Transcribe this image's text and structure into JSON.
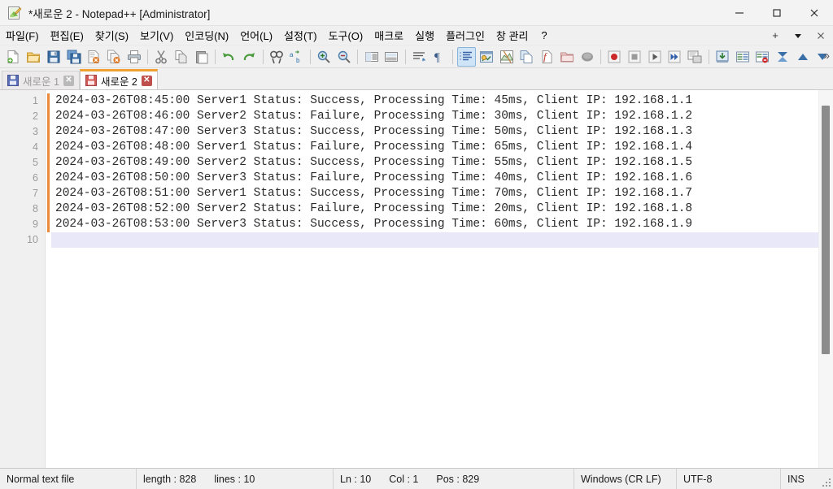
{
  "window": {
    "title": "*새로운 2 - Notepad++ [Administrator]",
    "app_icon": "notepad-plus-plus-icon",
    "controls": {
      "minimize": "—",
      "maximize": "☐",
      "close": "✕"
    }
  },
  "menubar": {
    "items": [
      {
        "label": "파일(F)",
        "name": "menu-file"
      },
      {
        "label": "편집(E)",
        "name": "menu-edit"
      },
      {
        "label": "찾기(S)",
        "name": "menu-search"
      },
      {
        "label": "보기(V)",
        "name": "menu-view"
      },
      {
        "label": "인코딩(N)",
        "name": "menu-encoding"
      },
      {
        "label": "언어(L)",
        "name": "menu-language"
      },
      {
        "label": "설정(T)",
        "name": "menu-settings"
      },
      {
        "label": "도구(O)",
        "name": "menu-tools"
      },
      {
        "label": "매크로",
        "name": "menu-macro"
      },
      {
        "label": "실행",
        "name": "menu-run"
      },
      {
        "label": "플러그인",
        "name": "menu-plugins"
      },
      {
        "label": "창 관리",
        "name": "menu-window"
      },
      {
        "label": "?",
        "name": "menu-help"
      }
    ],
    "right_buttons": [
      {
        "label": "+",
        "name": "new-tab-plus-button"
      },
      {
        "label": "▼",
        "name": "tab-list-chevron-down-icon"
      },
      {
        "label": "✕",
        "name": "close-document-button"
      }
    ]
  },
  "toolbar": {
    "overflow_label": "»",
    "groups": [
      [
        "new-file-icon",
        "open-file-icon",
        "save-icon",
        "save-all-icon",
        "close-file-icon",
        "close-all-files-icon",
        "print-icon"
      ],
      [
        "cut-icon",
        "copy-icon",
        "paste-icon"
      ],
      [
        "undo-icon",
        "redo-icon"
      ],
      [
        "find-icon",
        "replace-icon"
      ],
      [
        "zoom-in-icon",
        "zoom-out-icon"
      ],
      [
        "sync-vertical-scroll-icon",
        "sync-horizontal-scroll-icon"
      ],
      [
        "word-wrap-icon",
        "show-all-characters-icon"
      ],
      [
        "indent-guide-icon",
        "user-defined-dialog-icon",
        "document-map-icon",
        "document-list-icon",
        "function-list-icon",
        "folder-as-workspace-icon",
        "monitoring-icon"
      ],
      [
        "record-macro-icon",
        "stop-recording-icon",
        "play-macro-icon",
        "run-macro-multiple-icon",
        "save-macro-icon"
      ],
      [
        "run-icon",
        "compare-icon",
        "compare-clear-icon",
        "converge-icon",
        "previous-icon",
        "next-icon"
      ]
    ]
  },
  "tabs": [
    {
      "label": "새로운 1",
      "active": false,
      "modified": false,
      "close_label": "✕",
      "name": "tab-new-1"
    },
    {
      "label": "새로운 2",
      "active": true,
      "modified": true,
      "close_label": "✕",
      "name": "tab-new-2"
    }
  ],
  "editor": {
    "current_line": 10,
    "line_numbers": [
      "1",
      "2",
      "3",
      "4",
      "5",
      "6",
      "7",
      "8",
      "9",
      "10"
    ],
    "lines": [
      {
        "text": "2024-03-26T08:45:00 Server1 Status: Success, Processing Time: 45ms, Client IP: 192.168.1.1",
        "modified": true
      },
      {
        "text": "2024-03-26T08:46:00 Server2 Status: Failure, Processing Time: 30ms, Client IP: 192.168.1.2",
        "modified": true
      },
      {
        "text": "2024-03-26T08:47:00 Server3 Status: Success, Processing Time: 50ms, Client IP: 192.168.1.3",
        "modified": true
      },
      {
        "text": "2024-03-26T08:48:00 Server1 Status: Failure, Processing Time: 65ms, Client IP: 192.168.1.4",
        "modified": true
      },
      {
        "text": "2024-03-26T08:49:00 Server2 Status: Success, Processing Time: 55ms, Client IP: 192.168.1.5",
        "modified": true
      },
      {
        "text": "2024-03-26T08:50:00 Server3 Status: Failure, Processing Time: 40ms, Client IP: 192.168.1.6",
        "modified": true
      },
      {
        "text": "2024-03-26T08:51:00 Server1 Status: Success, Processing Time: 70ms, Client IP: 192.168.1.7",
        "modified": true
      },
      {
        "text": "2024-03-26T08:52:00 Server2 Status: Failure, Processing Time: 20ms, Client IP: 192.168.1.8",
        "modified": true
      },
      {
        "text": "2024-03-26T08:53:00 Server3 Status: Success, Processing Time: 60ms, Client IP: 192.168.1.9",
        "modified": true
      },
      {
        "text": "",
        "modified": false
      }
    ]
  },
  "statusbar": {
    "file_type": "Normal text file",
    "length_label": "length : 828",
    "lines_label": "lines : 10",
    "ln_label": "Ln : 10",
    "col_label": "Col : 1",
    "pos_label": "Pos : 829",
    "eol": "Windows (CR LF)",
    "encoding": "UTF-8",
    "insert_mode": "INS"
  },
  "colors": {
    "change_bar": "#eb8a38",
    "active_tab_accent": "#f0a030",
    "current_line_bg": "#e8e8f8",
    "chrome_bg": "#f0f0f0",
    "editor_bg": "#ffffff",
    "text": "#2b2b2b",
    "gutter_text": "#9b9b9b"
  }
}
